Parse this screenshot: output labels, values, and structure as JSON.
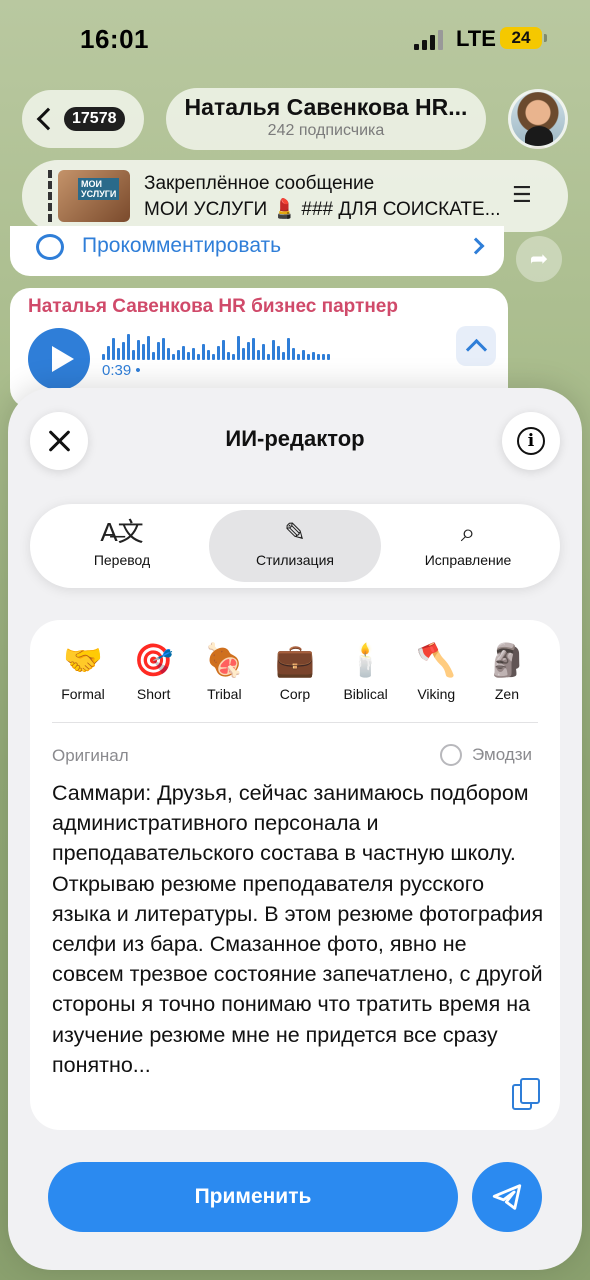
{
  "status_bar": {
    "time": "16:01",
    "network": "LTE",
    "battery": "24"
  },
  "header": {
    "unread_count": "17578",
    "channel_title": "Наталья Савенкова HR...",
    "subscribers": "242 подписчика"
  },
  "pinned": {
    "title": "Закреплённое сообщение",
    "text": "МОИ УСЛУГИ 💄 ### ДЛЯ СОИСКАТЕ..."
  },
  "comment": {
    "label": "Прокомментировать"
  },
  "voice": {
    "author": "Наталья Савенкова HR бизнес партнер",
    "duration": "0:39 •"
  },
  "editor": {
    "title": "ИИ-редактор",
    "tabs": [
      {
        "label": "Перевод",
        "icon": "translate-icon"
      },
      {
        "label": "Стилизация",
        "icon": "magic-pen-icon"
      },
      {
        "label": "Исправление",
        "icon": "check-search-icon"
      }
    ],
    "active_tab": "Стилизация",
    "styles": [
      {
        "emoji": "🤝",
        "label": "Formal"
      },
      {
        "emoji": "🎯",
        "label": "Short"
      },
      {
        "emoji": "🍖",
        "label": "Tribal"
      },
      {
        "emoji": "💼",
        "label": "Corp"
      },
      {
        "emoji": "🕯️",
        "label": "Biblical"
      },
      {
        "emoji": "🪓",
        "label": "Viking"
      },
      {
        "emoji": "🗿",
        "label": "Zen"
      }
    ],
    "original_label": "Оригинал",
    "emoji_toggle_label": "Эмодзи",
    "original_text": "Саммари: Друзья, сейчас занимаюсь подбором административного персонала и преподавательского состава в частную школу. Открываю резюме преподавателя русского языка и литературы. В этом резюме фотография селфи из бара. Смазанное фото,  явно не совсем трезвое состояние запечатлено, с другой стороны я точно понимаю что тратить время на изучение резюме мне не придется все сразу понятно...",
    "apply_label": "Применить"
  },
  "colors": {
    "accent": "#2b8af0",
    "link": "#2f7ed8",
    "author": "#d04a6a",
    "battery": "#f5c800"
  }
}
